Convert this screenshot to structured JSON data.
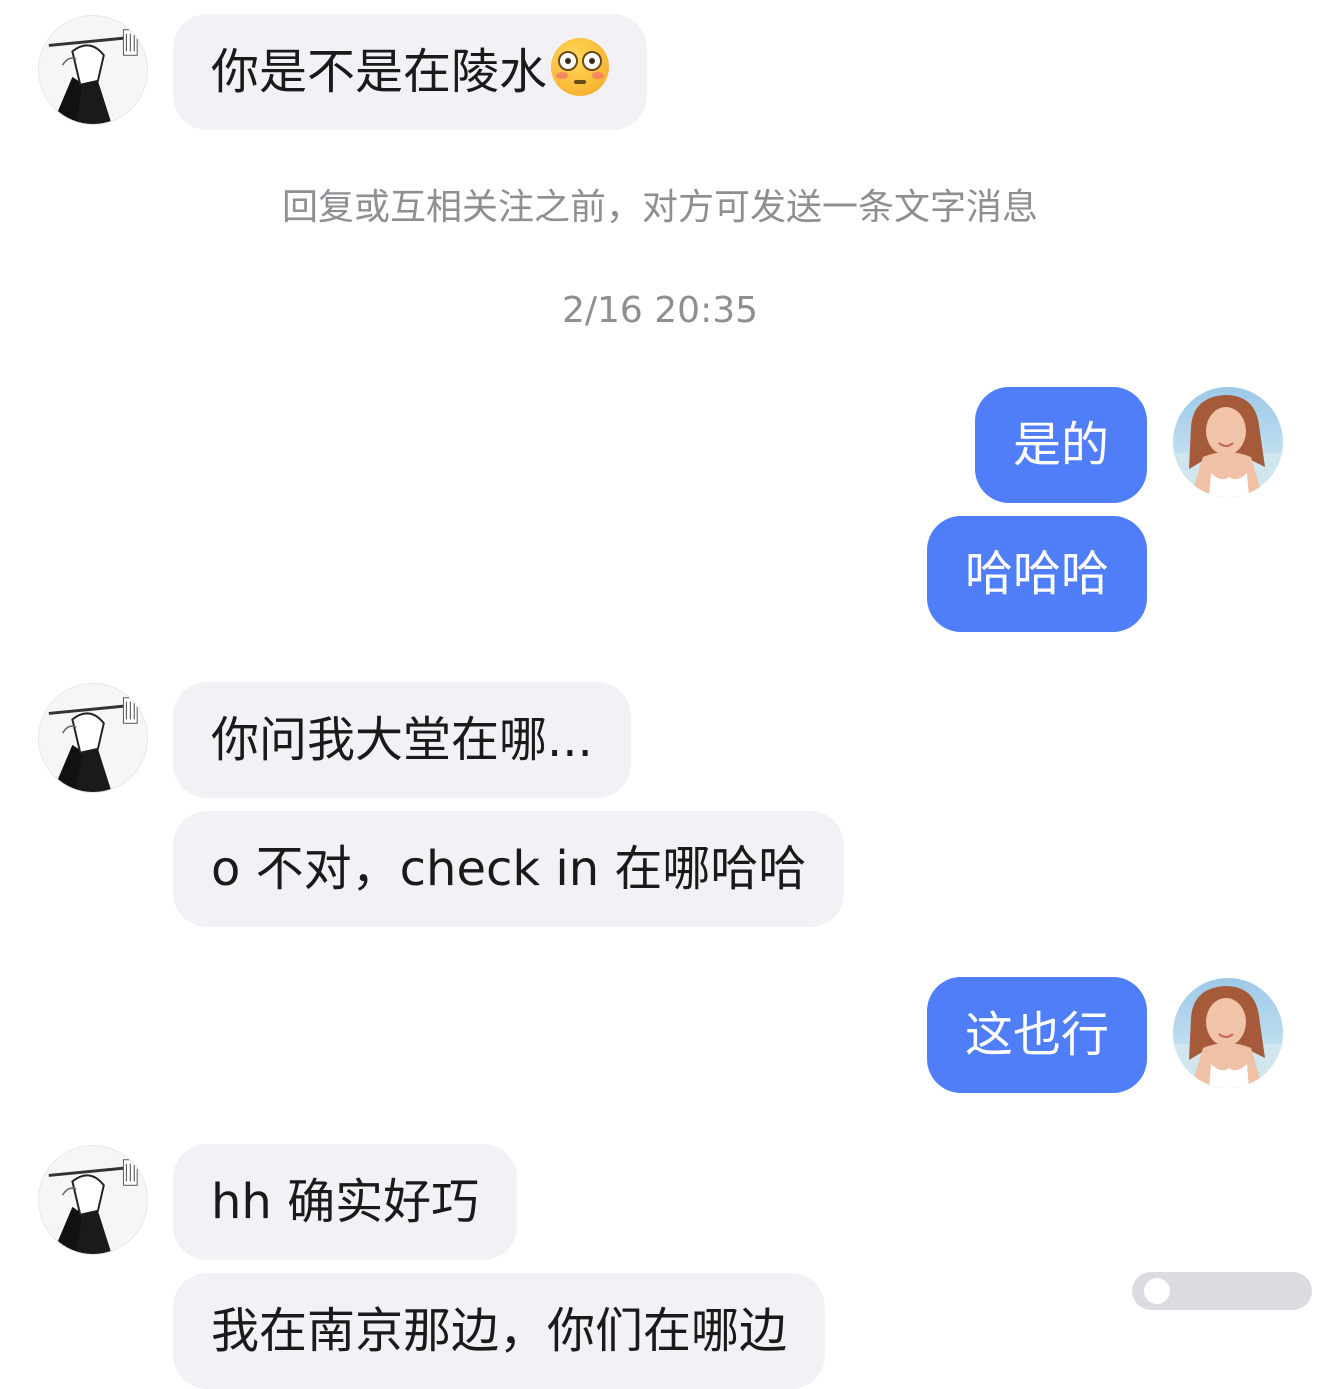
{
  "system_note": "回复或互相关注之前，对方可发送一条文字消息",
  "timestamp": "2/16 20:35",
  "messages": [
    {
      "side": "incoming",
      "text": "你是不是在陵水",
      "emoji": "flushed-face-emoji"
    },
    {
      "side": "outgoing",
      "text": "是的"
    },
    {
      "side": "outgoing",
      "text": "哈哈哈"
    },
    {
      "side": "incoming",
      "text": "你问我大堂在哪..."
    },
    {
      "side": "incoming",
      "text": "o 不对，check in 在哪哈哈"
    },
    {
      "side": "outgoing",
      "text": "这也行"
    },
    {
      "side": "incoming",
      "text": "hh 确实好巧"
    },
    {
      "side": "incoming",
      "text": "我在南京那边，你们在哪边"
    }
  ],
  "colors": {
    "incoming_bubble": "#f2f2f6",
    "outgoing_bubble": "#4f7ef8",
    "meta_text": "#8e8e93"
  }
}
